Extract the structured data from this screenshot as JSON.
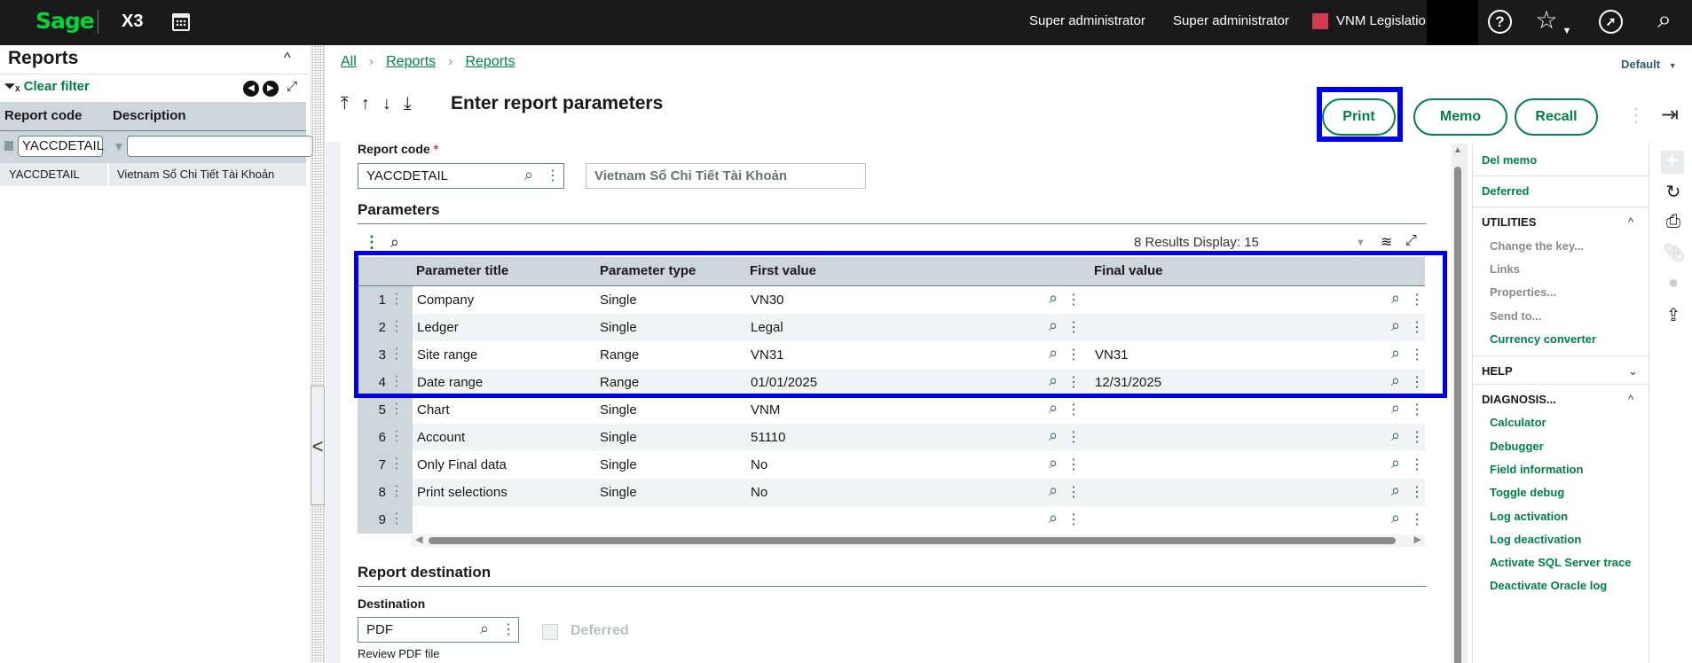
{
  "topbar": {
    "logo": "Sage",
    "product": "X3",
    "user1": "Super administrator",
    "user2": "Super administrator",
    "legislation": "VNM Legislation",
    "legislation_color": "#d23a4e",
    "icons": [
      "calendar-icon",
      "help-icon",
      "star-icon",
      "compass-icon",
      "search-icon"
    ]
  },
  "left_panel": {
    "title": "Reports",
    "clear_filter": "Clear filter",
    "columns": [
      "Report code",
      "Description"
    ],
    "filter_value": "YACCDETAIL",
    "filter_desc": "",
    "rows": [
      {
        "code": "YACCDETAIL",
        "description": "Vietnam Sổ Chi Tiết Tài Khoản"
      }
    ]
  },
  "breadcrumb": [
    "All",
    "Reports",
    "Reports"
  ],
  "page_title": "Enter report parameters",
  "view_selector": "Default",
  "actions": {
    "print": "Print",
    "memo": "Memo",
    "recall": "Recall"
  },
  "form": {
    "report_code_label": "Report code",
    "required_mark": "*",
    "report_code": "YACCDETAIL",
    "report_description": "Vietnam Sổ Chi Tiết Tài Khoản",
    "parameters_title": "Parameters",
    "results_text": "8 Results  Display:  15",
    "grid_columns": [
      "Parameter title",
      "Parameter type",
      "First value",
      "Final value"
    ],
    "grid_rows": [
      {
        "n": "1",
        "title": "Company",
        "type": "Single",
        "first": "VN30",
        "final": ""
      },
      {
        "n": "2",
        "title": "Ledger",
        "type": "Single",
        "first": "Legal",
        "final": ""
      },
      {
        "n": "3",
        "title": "Site range",
        "type": "Range",
        "first": "VN31",
        "final": "VN31"
      },
      {
        "n": "4",
        "title": "Date range",
        "type": "Range",
        "first": "01/01/2025",
        "final": "12/31/2025"
      },
      {
        "n": "5",
        "title": "Chart",
        "type": "Single",
        "first": "VNM",
        "final": ""
      },
      {
        "n": "6",
        "title": "Account",
        "type": "Single",
        "first": "51110",
        "final": ""
      },
      {
        "n": "7",
        "title": "Only Final data",
        "type": "Single",
        "first": "No",
        "final": ""
      },
      {
        "n": "8",
        "title": "Print selections",
        "type": "Single",
        "first": "No",
        "final": ""
      },
      {
        "n": "9",
        "title": "",
        "type": "",
        "first": "",
        "final": ""
      }
    ],
    "destination_section": "Report destination",
    "destination_label": "Destination",
    "destination_value": "PDF",
    "destination_desc": "Review PDF file",
    "deferred_label": "Deferred",
    "deferred_checked": false
  },
  "right_menu": {
    "del_memo": "Del memo",
    "deferred": "Deferred",
    "utilities": "UTILITIES",
    "utilities_items": [
      "Change the key...",
      "Links",
      "Properties...",
      "Send to..."
    ],
    "currency_converter": "Currency converter",
    "help": "HELP",
    "diagnosis": "DIAGNOSIS...",
    "diagnosis_items": [
      "Calculator",
      "Debugger",
      "Field information",
      "Toggle debug",
      "Log activation",
      "Log deactivation",
      "Activate SQL Server trace",
      "Deactivate Oracle log"
    ]
  },
  "colors": {
    "accent_green": "#00804a",
    "highlight_blue": "#0000e6",
    "header_gray": "#ccd6db"
  }
}
